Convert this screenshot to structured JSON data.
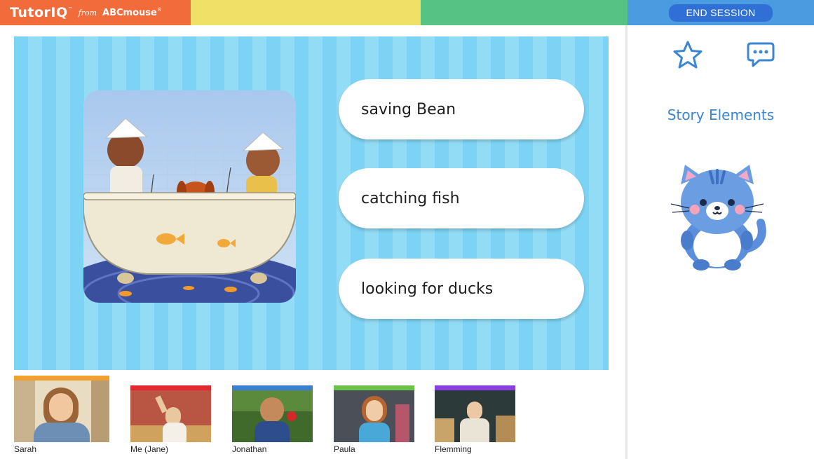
{
  "header": {
    "brand": "TutorIQ",
    "brand_tm": "™",
    "from": "from",
    "abc": "ABCmouse",
    "abc_reg": "®",
    "end_session": "END SESSION"
  },
  "activity": {
    "options": [
      {
        "label": "saving Bean"
      },
      {
        "label": "catching fish"
      },
      {
        "label": "looking for ducks"
      }
    ]
  },
  "sidebar": {
    "title": "Story Elements",
    "star_icon": "star-icon",
    "chat_icon": "chat-bubble-icon",
    "mascot": "cat-mascot"
  },
  "participants": [
    {
      "name": "Sarah",
      "color": "#f0a030"
    },
    {
      "name": "Me (Jane)",
      "color": "#e0282e"
    },
    {
      "name": "Jonathan",
      "color": "#3a7fd0"
    },
    {
      "name": "Paula",
      "color": "#6cc24a"
    },
    {
      "name": "Flemming",
      "color": "#8a3fe0"
    }
  ],
  "colors": {
    "orange": "#f26b3a",
    "yellow": "#f0e068",
    "green": "#56c384",
    "blue": "#4a9be0",
    "accent": "#3b86d3"
  }
}
